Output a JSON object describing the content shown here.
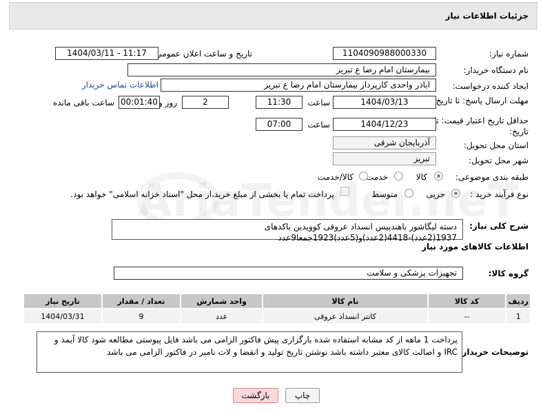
{
  "header": {
    "title": "جزئیات اطلاعات نیاز"
  },
  "fields": {
    "need_number_label": "شماره نیاز:",
    "need_number": "1104090988000330",
    "announce_label": "تاریخ و ساعت اعلان عمومی:",
    "announce_value": "1404/03/11 - 11:17",
    "buyer_label": "نام دستگاه خریدار:",
    "buyer_value": "بیمارستان امام رضا  ع  تبریز",
    "creator_label": "ایجاد کننده درخواست:",
    "creator_value": "اباذر واحدی کارپرداز بیمارستان امام رضا  ع  تبریز",
    "contact_link": "اطلاعات تماس خریدار",
    "deadline_label": "مهلت ارسال پاسخ: تا تاریخ:",
    "deadline_date": "1404/03/13",
    "time_label": "ساعت",
    "deadline_time": "11:30",
    "days_value": "2",
    "days_label": "روز و",
    "remaining_time": "00:01:40",
    "remaining_label": "ساعت باقی مانده",
    "validity_label": "حداقل تاریخ اعتبار قیمت: تا تاریخ:",
    "validity_date": "1404/12/23",
    "validity_time": "07:00",
    "province_label": "استان محل تحویل:",
    "province_value": "آذربایجان شرقی",
    "city_label": "شهر محل تحویل:",
    "city_value": "تبریز",
    "category_label": "طبقه بندی موضوعی:",
    "category_options": [
      "کالا",
      "خدمت",
      "کالا/خدمت"
    ],
    "process_label": "نوع فرآیند خرید :",
    "process_options": [
      "جزیی",
      "متوسط"
    ],
    "payment_note": "پرداخت تمام یا بخشی از مبلغ خرید،از محل \"اسناد خزانه اسلامی\" خواهد بود."
  },
  "need": {
    "label": "شرح کلی نیاز:",
    "text": "دسته لیگاشور باهندپیس انسداد عروقی کوویدین باکدهای 1937(2عدد)-4418(2عدد)و(5عدد)1923جمعا9عدد"
  },
  "goods": {
    "section_title": "اطلاعات کالاهای مورد نیاز",
    "group_label": "گروه کالا:",
    "group_value": "تجهیزات پزشکی و سلامت",
    "columns": [
      "ردیف",
      "کد کالا",
      "نام کالا",
      "واحد شمارش",
      "تعداد / مقدار",
      "تاریخ نیاز"
    ],
    "rows": [
      [
        "1",
        "--",
        "کاتتر انسداد عروقی",
        "عدد",
        "9",
        "1404/03/31"
      ]
    ]
  },
  "buyer_desc": {
    "label": "توضیحات خریدار:",
    "text": "پرداخت 1 ماهه از کد مشابه استفاده شده بارگزاری پیش فاکتور الزامی می باشد فایل پیوستی مطالعه شود کالا آیمد و IRC و اصالت کالای معتبر داشته باشد نوشتن تاریخ تولید و انقضا و لات نامبر در فاکتور الزامی می باشد"
  },
  "buttons": {
    "print": "چاپ",
    "back": "بازگشت"
  },
  "watermark": "AriaTender.neT",
  "colors": {
    "link": "#1a4ea8",
    "header_bg": "#e8e8e8",
    "table_head": "#c8c8c8",
    "back_btn_bg": "#f7d9d9"
  }
}
